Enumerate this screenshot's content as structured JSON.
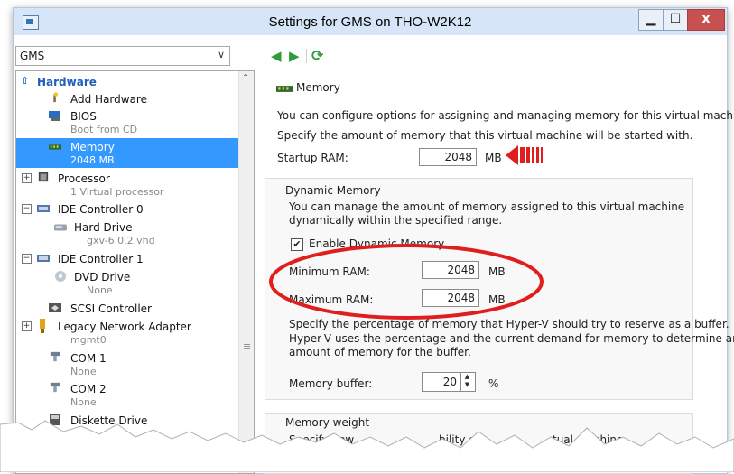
{
  "window": {
    "title": "Settings for GMS on THO-W2K12",
    "minimize": "▁",
    "maximize": "☐",
    "close": "x"
  },
  "vm_selector": {
    "value": "GMS"
  },
  "tree": {
    "section": "Hardware",
    "items": [
      {
        "label": "Add Hardware",
        "sub": ""
      },
      {
        "label": "BIOS",
        "sub": "Boot from CD"
      },
      {
        "label": "Memory",
        "sub": "2048 MB"
      },
      {
        "label": "Processor",
        "sub": "1 Virtual processor"
      },
      {
        "label": "IDE Controller 0",
        "sub": ""
      },
      {
        "label": "Hard Drive",
        "sub": "gxv-6.0.2.vhd"
      },
      {
        "label": "IDE Controller 1",
        "sub": ""
      },
      {
        "label": "DVD Drive",
        "sub": "None"
      },
      {
        "label": "SCSI Controller",
        "sub": ""
      },
      {
        "label": "Legacy Network Adapter",
        "sub": "mgmt0"
      },
      {
        "label": "COM 1",
        "sub": "None"
      },
      {
        "label": "COM 2",
        "sub": "None"
      },
      {
        "label": "Diskette Drive",
        "sub": ""
      }
    ]
  },
  "memory": {
    "group_title": "Memory",
    "intro1": "You can configure options for assigning and managing memory for this virtual machine.",
    "intro2": "Specify the amount of memory that this virtual machine will be started with.",
    "startup_label": "Startup RAM:",
    "startup_value": "2048",
    "unit_mb": "MB",
    "dynamic": {
      "title": "Dynamic Memory",
      "desc1": "You can manage the amount of memory assigned to this virtual machine",
      "desc2": "dynamically within the specified range.",
      "enable_label": "Enable Dynamic Memory",
      "enabled": true,
      "min_label": "Minimum RAM:",
      "min_value": "2048",
      "max_label": "Maximum RAM:",
      "max_value": "2048",
      "buffer_desc1": "Specify the percentage of memory that Hyper-V should try to reserve as a buffer.",
      "buffer_desc2": "Hyper-V uses the percentage and the current demand for memory to determine an",
      "buffer_desc3": "amount of memory for the buffer.",
      "buffer_label": "Memory buffer:",
      "buffer_value": "20",
      "buffer_unit": "%"
    },
    "weight": {
      "title": "Memory weight",
      "desc_left": "Specify how",
      "desc_mid": "bility of",
      "desc_right": "tual machine"
    }
  },
  "colors": {
    "selection": "#3399ff",
    "annotation_red": "#e01e1e",
    "nav_green": "#2e9c38"
  }
}
